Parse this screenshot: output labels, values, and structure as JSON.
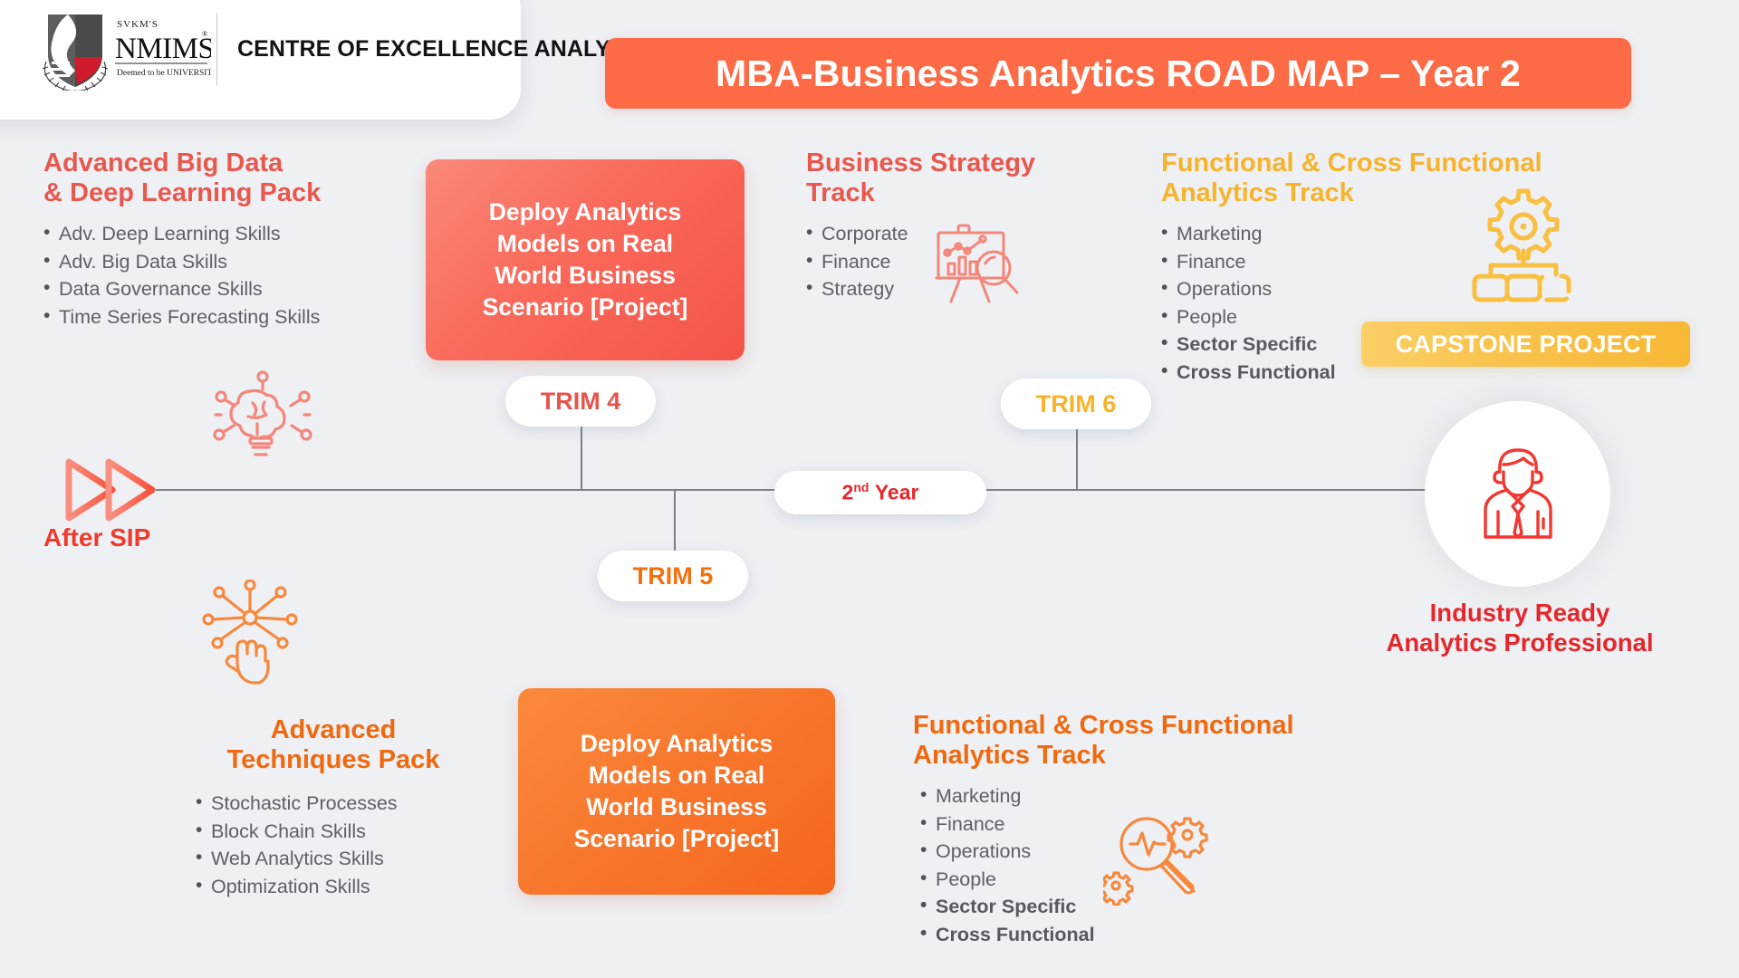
{
  "header": {
    "logo": {
      "svkm_label": "SVKM'S",
      "nmims_label": "NMIMS",
      "deemed_label": "Deemed to be UNIVERSITY",
      "registered_mark": "®",
      "shield_icon": "nmims-shield-logo-icon"
    },
    "coe_title": "CENTRE OF EXCELLENCE\nANALYTICS & DATA SCIENCE",
    "banner_title": "MBA-Business Analytics ROAD MAP – Year 2"
  },
  "colors": {
    "background": "#eef0f4",
    "banner_orange": "#fc6b45",
    "coral_red": "#e8584e",
    "pure_orange": "#f0690f",
    "golden_yellow": "#f7b32b",
    "bright_red": "#e6262b",
    "bullet_gray": "#5d6066"
  },
  "timeline": {
    "start_label": "After SIP",
    "start_icon": "fast-forward-double-arrow-icon",
    "center_pill": {
      "number": "2",
      "ordinal": "nd",
      "text": "Year"
    },
    "trimesters": [
      {
        "label": "TRIM 4",
        "color": "#e8534a"
      },
      {
        "label": "TRIM 5",
        "color": "#f2710f"
      },
      {
        "label": "TRIM 6",
        "color": "#f7b32b"
      }
    ]
  },
  "blocks": {
    "big_data": {
      "heading": "Advanced Big Data\n& Deep Learning Pack",
      "items": [
        "Adv. Deep Learning Skills",
        "Adv. Big Data Skills",
        "Data Governance Skills",
        "Time Series Forecasting Skills"
      ],
      "icon": "brain-circuit-lightbulb-icon"
    },
    "deploy_top": {
      "text": "Deploy Analytics\nModels on Real\nWorld Business\nScenario [Project]"
    },
    "business_strategy": {
      "heading": "Business Strategy\nTrack",
      "items": [
        "Corporate",
        "Finance",
        "Strategy"
      ],
      "icon": "presentation-chart-magnifier-icon"
    },
    "functional_top": {
      "heading": "Functional & Cross Functional\nAnalytics Track",
      "items": [
        {
          "label": "Marketing",
          "bold": false
        },
        {
          "label": "Finance",
          "bold": false
        },
        {
          "label": "Operations",
          "bold": false
        },
        {
          "label": "People",
          "bold": false
        },
        {
          "label": "Sector Specific",
          "bold": true
        },
        {
          "label": "Cross Functional",
          "bold": true
        }
      ],
      "icon": "gear-hierarchy-icon"
    },
    "capstone": {
      "label": "CAPSTONE PROJECT"
    },
    "outcome": {
      "icon": "business-professional-person-icon",
      "label": "Industry Ready\nAnalytics Professional"
    },
    "advanced_techniques": {
      "heading": "Advanced\nTechniques Pack",
      "items": [
        "Stochastic Processes",
        "Block Chain Skills",
        "Web Analytics Skills",
        "Optimization Skills"
      ],
      "icon": "neural-network-hand-icon"
    },
    "deploy_bottom": {
      "text": "Deploy Analytics\nModels on Real\nWorld Business\nScenario [Project]"
    },
    "functional_bottom": {
      "heading": "Functional & Cross Functional\nAnalytics Track",
      "items": [
        {
          "label": "Marketing",
          "bold": false
        },
        {
          "label": "Finance",
          "bold": false
        },
        {
          "label": "Operations",
          "bold": false
        },
        {
          "label": "People",
          "bold": false
        },
        {
          "label": "Sector Specific",
          "bold": true
        },
        {
          "label": "Cross Functional",
          "bold": true
        }
      ],
      "icon": "pulse-magnifier-gears-icon"
    }
  }
}
